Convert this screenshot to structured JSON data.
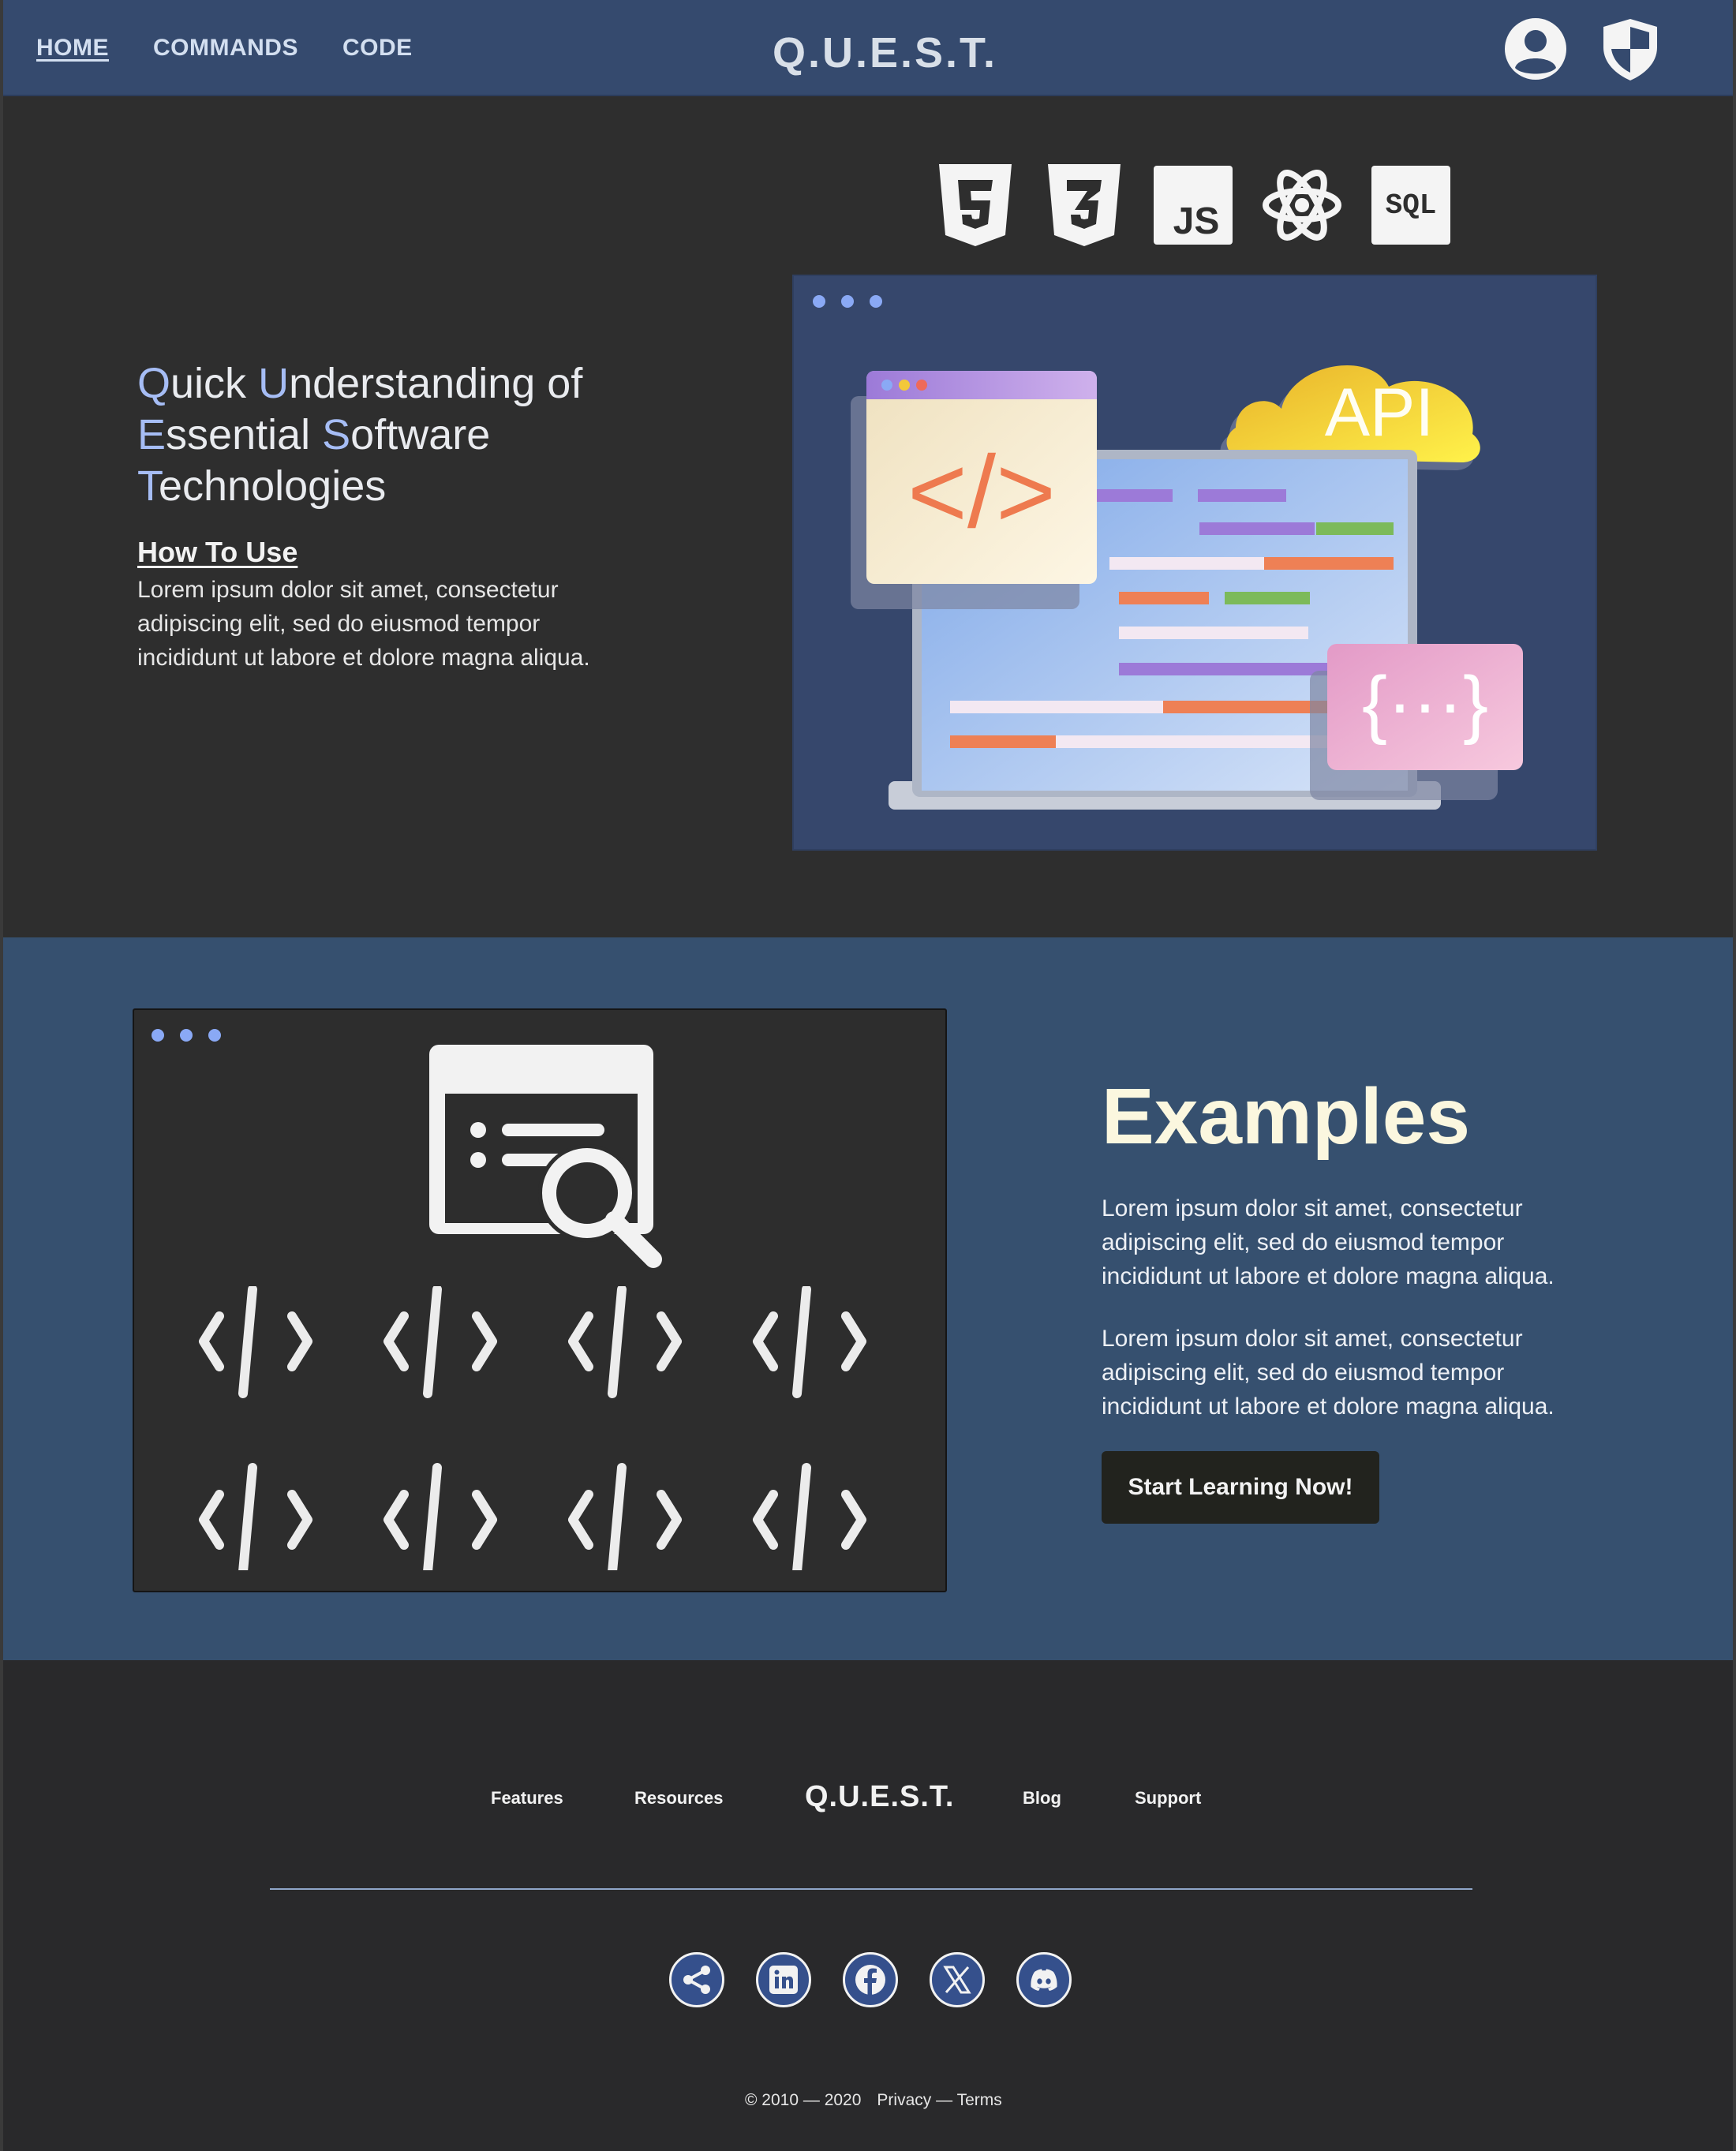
{
  "nav": {
    "links": [
      "HOME",
      "COMMANDS",
      "CODE"
    ],
    "brand": "Q.U.E.S.T.",
    "icons": [
      "user-icon",
      "shield-icon"
    ]
  },
  "hero": {
    "title_parts": [
      {
        "accent": "Q",
        "rest": "uick "
      },
      {
        "accent": "U",
        "rest": "nderstanding of "
      },
      {
        "accent": "E",
        "rest": "ssential "
      },
      {
        "accent": "S",
        "rest": "oftware "
      },
      {
        "accent": "T",
        "rest": "echnologies"
      }
    ],
    "how_to_use": "How To Use",
    "description": "Lorem ipsum dolor sit amet, consectetur adipiscing elit, sed do eiusmod tempor incididunt ut labore et dolore magna aliqua.",
    "tech_icons": [
      "html5-icon",
      "css3-icon",
      "js-icon",
      "react-icon",
      "sql-icon"
    ],
    "tech_labels": {
      "js": "JS",
      "sql": "SQL"
    },
    "illustration": {
      "api_label": "API",
      "code_tag": "</>",
      "braces": "{···}"
    }
  },
  "examples": {
    "title": "Examples",
    "paragraphs": [
      "Lorem ipsum dolor sit amet, consectetur adipiscing elit, sed do eiusmod tempor incididunt ut labore et dolore magna aliqua.",
      "Lorem ipsum dolor sit amet, consectetur adipiscing elit, sed do eiusmod tempor incididunt ut labore et dolore magna aliqua."
    ],
    "cta": "Start Learning Now!",
    "code_glyph": "</>"
  },
  "footer": {
    "links_left": [
      "Features",
      "Resources"
    ],
    "brand": "Q.U.E.S.T.",
    "links_right": [
      "Blog",
      "Support"
    ],
    "socials": [
      "share-icon",
      "linkedin-icon",
      "facebook-icon",
      "x-icon",
      "discord-icon"
    ],
    "copyright": "© 2010 — 2020",
    "privacy": "Privacy",
    "sep": "—",
    "terms": "Terms"
  },
  "colors": {
    "nav_bg": "#354a6e",
    "page_bg": "#2e2e2e",
    "examples_bg": "#36506f",
    "accent": "#a6bdf5",
    "footer_bg": "#29292b"
  }
}
